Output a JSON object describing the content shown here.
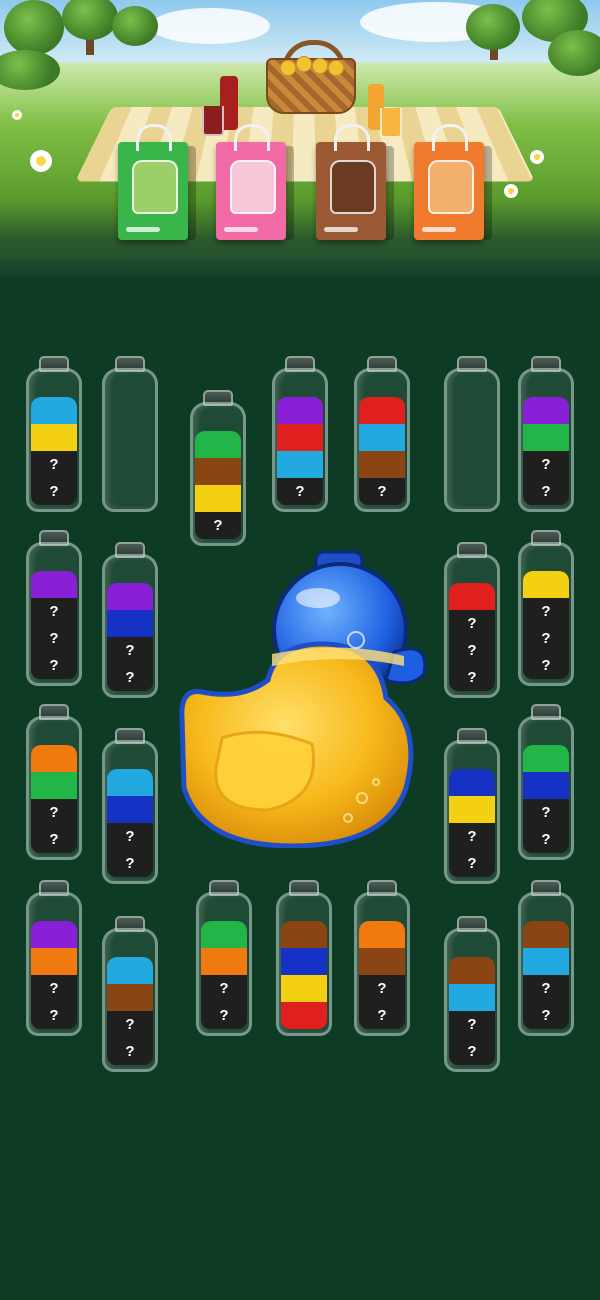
{
  "colors": {
    "cyan": "#22a9e0",
    "yellow": "#f4d012",
    "green": "#22b548",
    "brown": "#8b4513",
    "purple": "#8a1fd8",
    "red": "#e01f1f",
    "blue": "#1632c4",
    "orange": "#f07a10",
    "hidden": "#1f1f1f"
  },
  "hidden_label": "?",
  "shopping_bags": [
    {
      "name": "green-drink-bag",
      "color": "#3ab54a",
      "drink": "#9ccf6a"
    },
    {
      "name": "pink-drink-bag",
      "color": "#f26aa6",
      "drink": "#f7c6d9"
    },
    {
      "name": "brown-drink-bag",
      "color": "#9b5a33",
      "drink": "#6b3a22"
    },
    {
      "name": "orange-drink-bag",
      "color": "#f07b2e",
      "drink": "#f3b06b"
    }
  ],
  "bottles": [
    {
      "id": "b1",
      "layers": [
        "hidden",
        "hidden",
        "yellow",
        "cyan"
      ]
    },
    {
      "id": "b2",
      "layers": []
    },
    {
      "id": "b3",
      "layers": [
        "hidden",
        "yellow",
        "brown",
        "green"
      ]
    },
    {
      "id": "b4",
      "layers": [
        "hidden",
        "cyan",
        "red",
        "purple"
      ]
    },
    {
      "id": "b5",
      "layers": [
        "hidden",
        "brown",
        "cyan",
        "red"
      ]
    },
    {
      "id": "b6",
      "layers": []
    },
    {
      "id": "b7",
      "layers": [
        "hidden",
        "hidden",
        "green",
        "purple"
      ]
    },
    {
      "id": "b8",
      "layers": [
        "hidden",
        "hidden",
        "hidden",
        "purple"
      ]
    },
    {
      "id": "b9",
      "layers": [
        "hidden",
        "hidden",
        "blue",
        "purple"
      ]
    },
    {
      "id": "b10",
      "layers": [
        "hidden",
        "hidden",
        "hidden",
        "red"
      ]
    },
    {
      "id": "b11",
      "layers": [
        "hidden",
        "hidden",
        "hidden",
        "yellow"
      ]
    },
    {
      "id": "b12",
      "layers": [
        "hidden",
        "hidden",
        "green",
        "orange"
      ]
    },
    {
      "id": "b13",
      "layers": [
        "hidden",
        "hidden",
        "blue",
        "cyan"
      ]
    },
    {
      "id": "b14",
      "layers": [
        "hidden",
        "hidden",
        "yellow",
        "blue"
      ]
    },
    {
      "id": "b15",
      "layers": [
        "hidden",
        "hidden",
        "blue",
        "green"
      ]
    },
    {
      "id": "b16",
      "layers": [
        "hidden",
        "hidden",
        "orange",
        "purple"
      ]
    },
    {
      "id": "b17",
      "layers": [
        "hidden",
        "hidden",
        "brown",
        "cyan"
      ]
    },
    {
      "id": "b18",
      "layers": [
        "hidden",
        "hidden",
        "orange",
        "green"
      ]
    },
    {
      "id": "b19",
      "layers": [
        "red",
        "yellow",
        "blue",
        "brown"
      ]
    },
    {
      "id": "b20",
      "layers": [
        "hidden",
        "hidden",
        "brown",
        "orange"
      ]
    },
    {
      "id": "b21",
      "layers": [
        "hidden",
        "hidden",
        "cyan",
        "brown"
      ]
    },
    {
      "id": "b22",
      "layers": [
        "hidden",
        "hidden",
        "cyan",
        "brown"
      ]
    }
  ],
  "bonus_duck": {
    "liquid": "#f7b81a",
    "glass": "#1e5ee0"
  }
}
